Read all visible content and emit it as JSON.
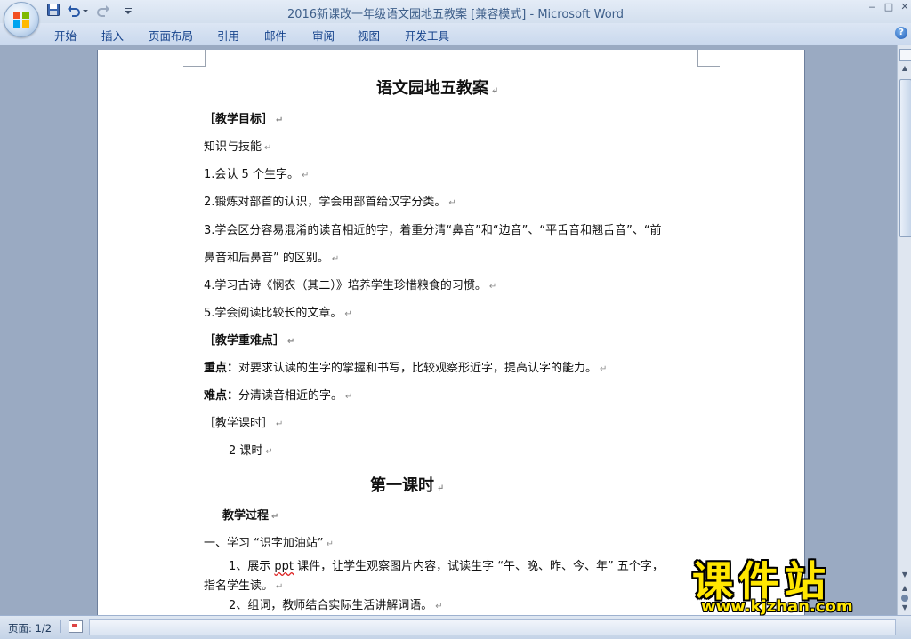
{
  "window": {
    "title_doc": "2016新课改一年级语文园地五教案 [兼容模式]",
    "title_sep": " - ",
    "title_app": "Microsoft Word",
    "min_label": "‒",
    "max_label": "□",
    "close_label": "✕"
  },
  "ribbon": {
    "tabs": [
      "开始",
      "插入",
      "页面布局",
      "引用",
      "邮件",
      "审阅",
      "视图",
      "开发工具"
    ],
    "help_label": "?"
  },
  "document": {
    "title": "语文园地五教案",
    "section1": "［教学目标］",
    "knowledge": "知识与技能",
    "goal1": "1.会认 5 个生字。",
    "goal2": "2.锻炼对部首的认识，学会用部首给汉字分类。",
    "goal3a": "3.学会区分容易混淆的读音相近的字，着重分清“鼻音”和“边音”、“平舌音和翘舌音”、“前",
    "goal3b": "鼻音和后鼻音” 的区别。",
    "goal4": "4.学习古诗《悯农（其二）》培养学生珍惜粮食的习惯。",
    "goal5": "5.学会阅读比较长的文章。",
    "section2": "［教学重难点］",
    "key_label": "重点：",
    "key_text": "对要求认读的生字的掌握和书写，比较观察形近字，提高认字的能力。",
    "diff_label": "难点：",
    "diff_text": "分清读音相近的字。",
    "section3": "［教学课时］",
    "hours": "2 课时",
    "lesson1": "第一课时",
    "process": "教学过程",
    "step1": "一、学习 “识字加油站”",
    "step1_1a": "1、展示 ",
    "step1_1ppt": "ppt",
    "step1_1b": " 课件，让学生观察图片内容，试读生字 “午、晚、昨、今、年” 五个字，",
    "step1_1c": "指名学生读。",
    "step1_2": "2、组词，教师结合实际生活讲解词语。",
    "pilcrow": "↵"
  },
  "statusbar": {
    "page": "页面: 1/2"
  },
  "watermark": {
    "big": "课件站",
    "url": "www.kjzhan.com"
  }
}
